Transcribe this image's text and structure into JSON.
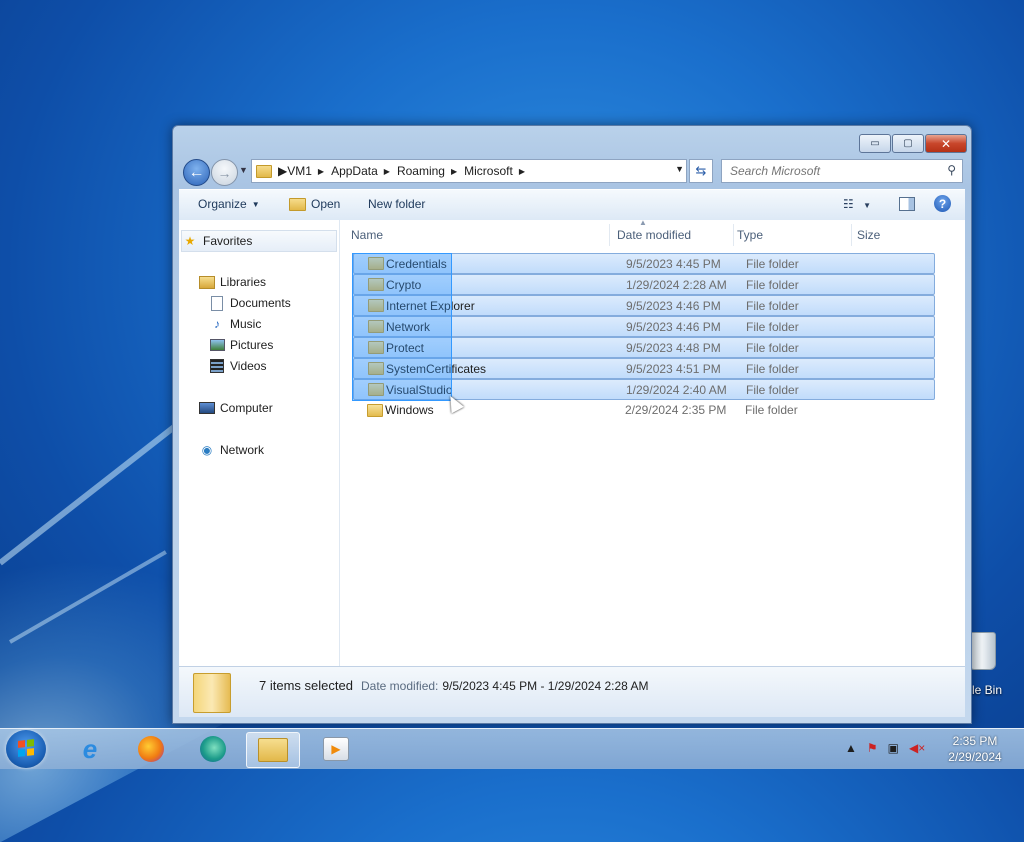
{
  "desktop": {
    "recycle_bin_label": "cle Bin"
  },
  "window": {
    "controls": {
      "minimize": "▭",
      "maximize": "▢",
      "close": "✕"
    },
    "address": {
      "crumbs": [
        "VM1",
        "AppData",
        "Roaming",
        "Microsoft"
      ]
    },
    "search": {
      "placeholder": "Search Microsoft"
    }
  },
  "toolbar": {
    "organize": "Organize",
    "open": "Open",
    "new_folder": "New folder"
  },
  "nav": {
    "favorites": "Favorites",
    "libraries": "Libraries",
    "documents": "Documents",
    "music": "Music",
    "pictures": "Pictures",
    "videos": "Videos",
    "computer": "Computer",
    "network": "Network"
  },
  "columns": {
    "name": "Name",
    "date": "Date modified",
    "type": "Type",
    "size": "Size"
  },
  "files": [
    {
      "name": "Credentials",
      "date": "9/5/2023 4:45 PM",
      "type": "File folder"
    },
    {
      "name": "Crypto",
      "date": "1/29/2024 2:28 AM",
      "type": "File folder"
    },
    {
      "name": "Internet Explorer",
      "date": "9/5/2023 4:46 PM",
      "type": "File folder"
    },
    {
      "name": "Network",
      "date": "9/5/2023 4:46 PM",
      "type": "File folder"
    },
    {
      "name": "Protect",
      "date": "9/5/2023 4:48 PM",
      "type": "File folder"
    },
    {
      "name": "SystemCertificates",
      "date": "9/5/2023 4:51 PM",
      "type": "File folder"
    },
    {
      "name": "VisualStudio",
      "date": "1/29/2024 2:40 AM",
      "type": "File folder"
    },
    {
      "name": "Windows",
      "date": "2/29/2024 2:35 PM",
      "type": "File folder"
    }
  ],
  "details": {
    "selection": "7 items selected",
    "date_label": "Date modified:",
    "date_range": "9/5/2023 4:45 PM - 1/29/2024 2:28 AM"
  },
  "taskbar": {
    "time": "2:35 PM",
    "date": "2/29/2024"
  }
}
